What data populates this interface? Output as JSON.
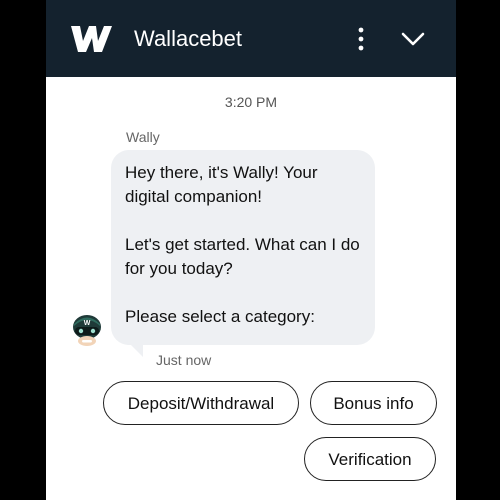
{
  "header": {
    "brand": "Wallacebet",
    "logo_icon": "wallacebet-w-logo",
    "menu_icon": "more-vertical-icon",
    "collapse_icon": "chevron-down-icon",
    "background_color": "#14222e"
  },
  "chat": {
    "timestamp": "3:20 PM",
    "sender": "Wally",
    "message_lines": [
      "Hey there, it's Wally! Your digital companion!",
      "Let's get started. What can I do for you today?",
      "Please select a category:"
    ],
    "message_time": "Just now",
    "avatar_icon": "wally-bot-avatar-icon",
    "bubble_color": "#eef0f3"
  },
  "quick_replies": [
    {
      "label": "Deposit/Withdrawal"
    },
    {
      "label": "Bonus info"
    },
    {
      "label": "Verification"
    }
  ]
}
